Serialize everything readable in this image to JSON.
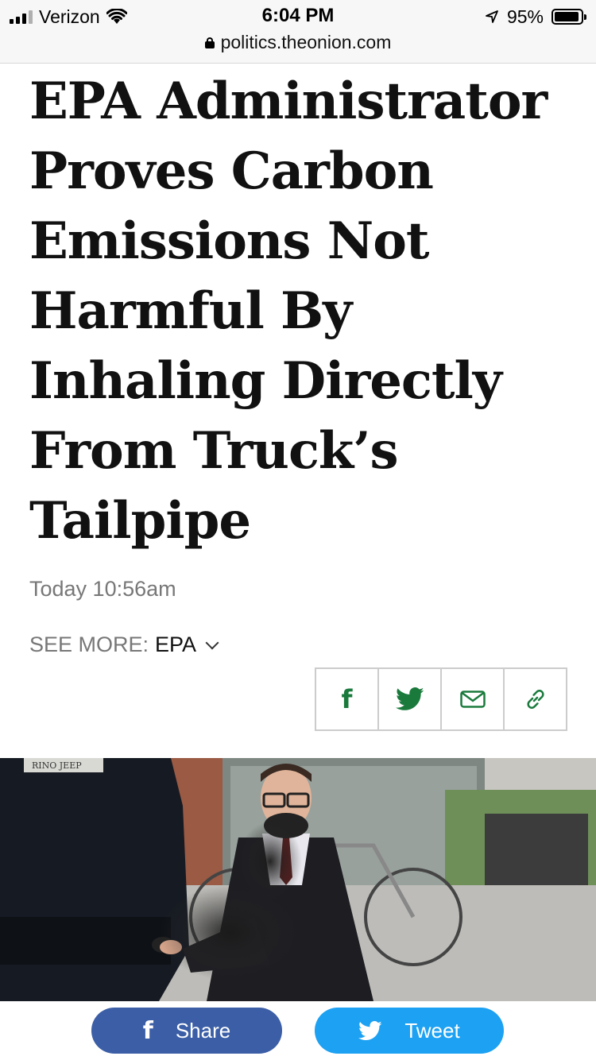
{
  "status_bar": {
    "carrier": "Verizon",
    "time": "6:04 PM",
    "battery": "95%",
    "battery_level": 0.95,
    "signal_bars": 3
  },
  "url_bar": {
    "domain": "politics.theonion.com"
  },
  "article": {
    "headline": "EPA Administrator Proves Carbon Emissions Not Harmful By Inhaling Directly From Truck’s Tailpipe",
    "timestamp": "Today 10:56am",
    "see_more_label": "SEE MORE:",
    "see_more_tag": "EPA"
  },
  "share_icons": [
    "facebook-icon",
    "twitter-icon",
    "mail-icon",
    "link-icon"
  ],
  "photo": {
    "plate_text": "RINO JEEP"
  },
  "bottom_bar": {
    "share_label": "Share",
    "tweet_label": "Tweet"
  },
  "colors": {
    "accent_green": "#1a7a3c",
    "facebook_blue": "#3b5ea6",
    "twitter_blue": "#1da1f2"
  }
}
